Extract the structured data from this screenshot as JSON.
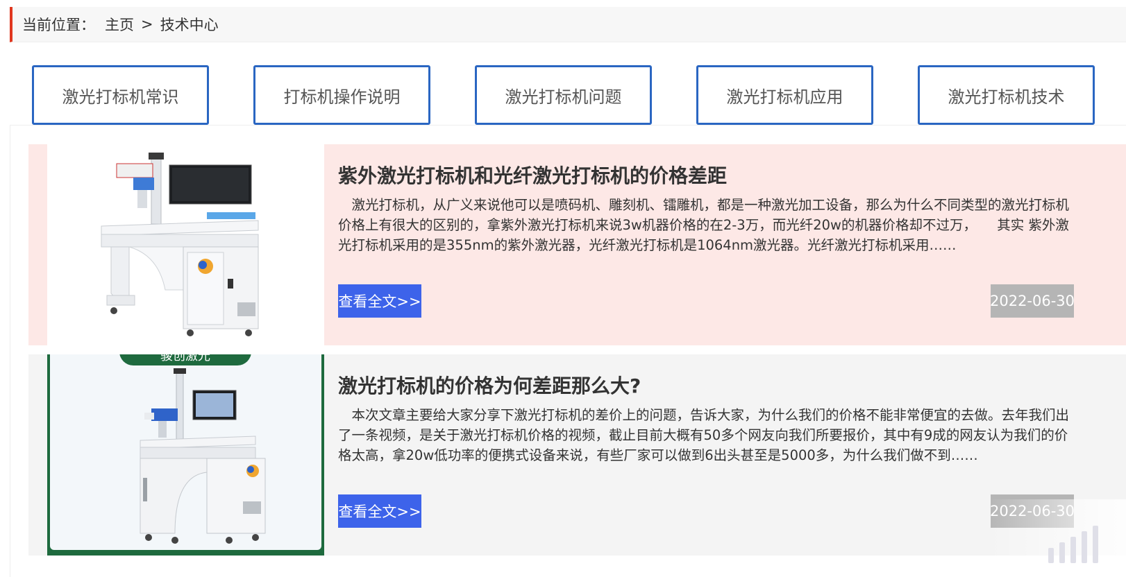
{
  "breadcrumb": {
    "label": "当前位置：",
    "home": "主页",
    "separator": ">",
    "current": "技术中心"
  },
  "tabs": [
    {
      "label": "激光打标机常识"
    },
    {
      "label": "打标机操作说明"
    },
    {
      "label": "激光打标机问题"
    },
    {
      "label": "激光打标机应用"
    },
    {
      "label": "激光打标机技术"
    }
  ],
  "articles": [
    {
      "title": "紫外激光打标机和光纤激光打标机的价格差距",
      "summary": "激光打标机，从广义来说他可以是喷码机、雕刻机、镭雕机，都是一种激光加工设备，那么为什么不同类型的激光打标机价格上有很大的区别的，拿紫外激光打标机来说3w机器价格的在2-3万，而光纤20w的机器价格却不过万，　　其实 紫外激光打标机采用的是355nm的紫外激光器，光纤激光打标机是1064nm激光器。光纤激光打标机采用……",
      "read_more": "查看全文>>",
      "date": "2022-06-30"
    },
    {
      "title": "激光打标机的价格为何差距那么大?",
      "summary": "本次文章主要给大家分享下激光打标机的差价上的问题，告诉大家，为什么我们的价格不能非常便宜的去做。去年我们出了一条视频，是关于激光打标机价格的视频，截止目前大概有50多个网友向我们所要报价，其中有9成的网友认为我们的价格太高，拿20w低功率的便携式设备来说，有些厂家可以做到6出头甚至是5000多，为什么我们做不到……",
      "read_more": "查看全文>>",
      "date": "2022-06-30",
      "banner_text": "骏创激光"
    }
  ],
  "colors": {
    "accent_blue": "#2a66c2",
    "button_blue": "#3d63ea",
    "breadcrumb_bar": "#e0371f",
    "article1_bg": "#fde8e6",
    "article2_bg": "#f4f4f4",
    "date_bg": "#b5b5b5",
    "brand_green": "#1e6a3e"
  }
}
